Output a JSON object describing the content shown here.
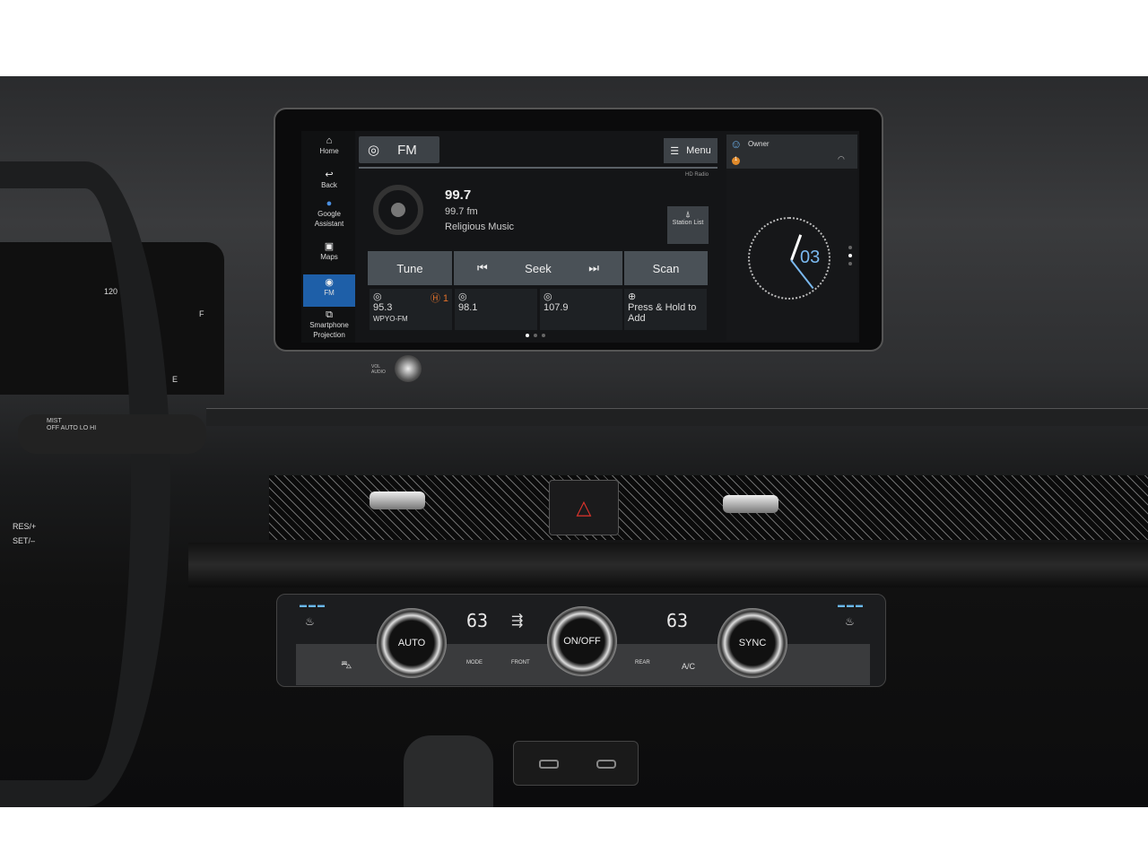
{
  "infotainment": {
    "sidebar": [
      {
        "label": "Home",
        "icon": "home-icon"
      },
      {
        "label": "Back",
        "icon": "back-icon"
      },
      {
        "label": "Google Assistant",
        "icon": "microphone-icon"
      },
      {
        "label": "Maps",
        "icon": "map-icon"
      },
      {
        "label": "FM",
        "icon": "radio-icon",
        "active": true
      },
      {
        "label": "Smartphone Projection",
        "icon": "phone-projection-icon"
      }
    ],
    "source_tab": "FM",
    "menu_label": "Menu",
    "hd_radio_label": "HD Radio",
    "now_playing": {
      "frequency": "99.7",
      "station": "99.7 fm",
      "genre": "Religious Music"
    },
    "station_list_label": "Station List",
    "controls": {
      "tune": "Tune",
      "seek": "Seek",
      "scan": "Scan"
    },
    "presets": [
      {
        "frequency": "95.3",
        "name": "WPYO-FM",
        "hd_channel": "1"
      },
      {
        "frequency": "98.1",
        "name": ""
      },
      {
        "frequency": "107.9",
        "name": ""
      },
      {
        "add_label": "Press & Hold to Add"
      }
    ],
    "page_dots": 3,
    "active_page": 1,
    "status": {
      "profile": "Owner",
      "notification_count": "1"
    },
    "clock": {
      "minute_label": "03"
    },
    "accent_color": "#1e5fa8"
  },
  "climate": {
    "driver_temp": "63",
    "passenger_temp": "63",
    "left_knob": "AUTO",
    "center_knob": "ON/OFF",
    "right_knob": "SYNC",
    "mode_label": "MODE",
    "front_label": "FRONT",
    "rear_label": "REAR",
    "ac_label": "A/C"
  },
  "console": {
    "volume_label": "VOL AUDIO"
  },
  "cluster": {
    "speed_tick": "120",
    "fuel_full": "F",
    "fuel_empty": "E"
  },
  "stalk": {
    "labels": [
      "MIST",
      "OFF",
      "AUTO",
      "LO",
      "HI"
    ]
  },
  "wheel": {
    "res_label": "RES/+",
    "set_label": "SET/–"
  }
}
